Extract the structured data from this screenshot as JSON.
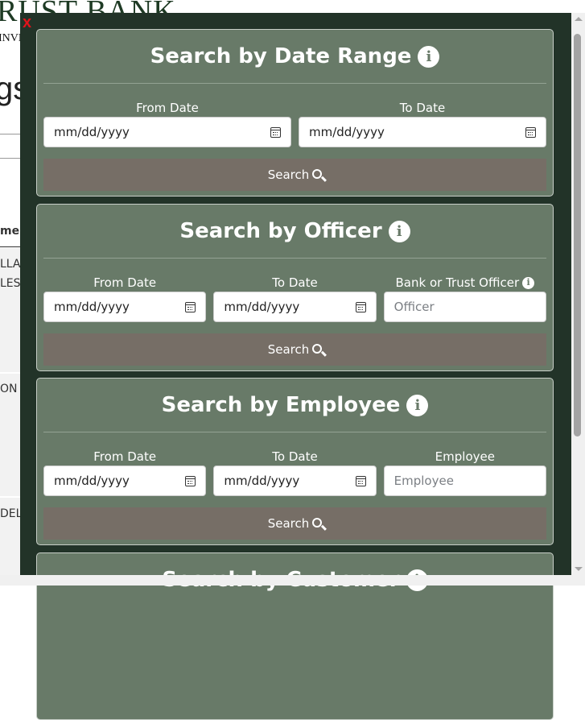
{
  "background": {
    "logo": "RUST BANK",
    "logo_sub": "INVE",
    "heading": "gs",
    "col_header": "mer",
    "cells": [
      "LLA",
      "LES",
      "ON",
      "DEL"
    ]
  },
  "modal": {
    "close": "x"
  },
  "sections": [
    {
      "title": "Search by Date Range",
      "fields": [
        {
          "label": "From Date",
          "value": "mm/dd/yyyy"
        },
        {
          "label": "To Date",
          "value": "mm/dd/yyyy"
        }
      ],
      "button": "Search"
    },
    {
      "title": "Search by Officer",
      "fields": [
        {
          "label": "From Date",
          "value": "mm/dd/yyyy"
        },
        {
          "label": "To Date",
          "value": "mm/dd/yyyy"
        },
        {
          "label": "Bank or Trust Officer",
          "placeholder": "Officer"
        }
      ],
      "button": "Search"
    },
    {
      "title": "Search by Employee",
      "fields": [
        {
          "label": "From Date",
          "value": "mm/dd/yyyy"
        },
        {
          "label": "To Date",
          "value": "mm/dd/yyyy"
        },
        {
          "label": "Employee",
          "placeholder": "Employee"
        }
      ],
      "button": "Search"
    },
    {
      "title": "Search by Customer"
    }
  ],
  "colors": {
    "modal": "#223328",
    "card": "#687a68",
    "button": "#766e66",
    "close": "#e0141b"
  }
}
